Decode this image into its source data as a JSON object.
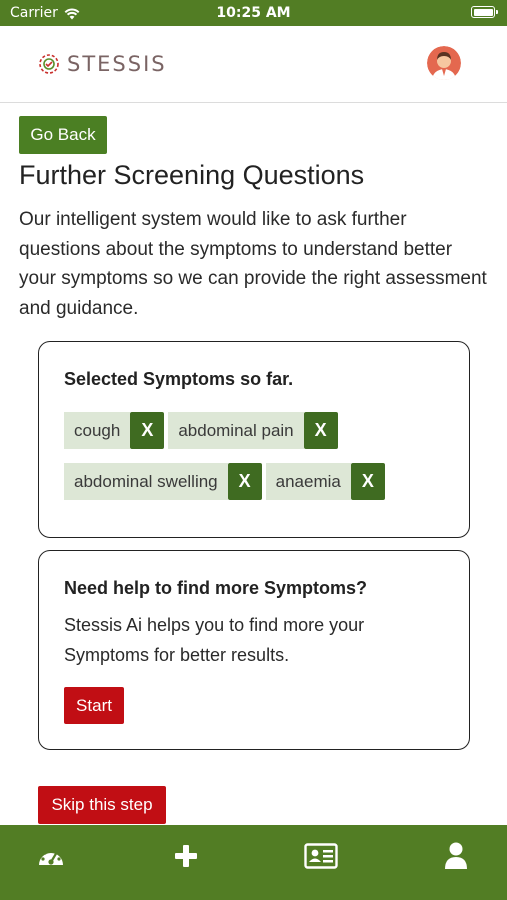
{
  "status_bar": {
    "carrier": "Carrier",
    "time": "10:25 AM"
  },
  "header": {
    "logo_text": "STESSIS"
  },
  "actions": {
    "go_back": "Go Back",
    "skip": "Skip this step"
  },
  "page": {
    "title": "Further Screening Questions",
    "intro": "Our intelligent system would like to ask further questions about the symptoms to understand better your symptoms so we can provide the right assessment and guidance."
  },
  "selected_symptoms": {
    "title": "Selected Symptoms so far.",
    "remove_label": "X",
    "rows": [
      [
        "cough",
        "abdominal pain"
      ],
      [
        "abdominal swelling",
        "anaemia"
      ]
    ]
  },
  "help_card": {
    "title": "Need help to find more Symptoms?",
    "description": "Stessis Ai helps you to find more your Symptoms for better results.",
    "start": "Start"
  },
  "tabs": [
    {
      "icon": "dashboard-icon"
    },
    {
      "icon": "plus-icon"
    },
    {
      "icon": "id-card-icon"
    },
    {
      "icon": "user-icon"
    }
  ],
  "colors": {
    "brand_green": "#527d24",
    "button_green": "#4b7f23",
    "chip_bg": "#dde7d6",
    "danger_red": "#c10e14"
  }
}
